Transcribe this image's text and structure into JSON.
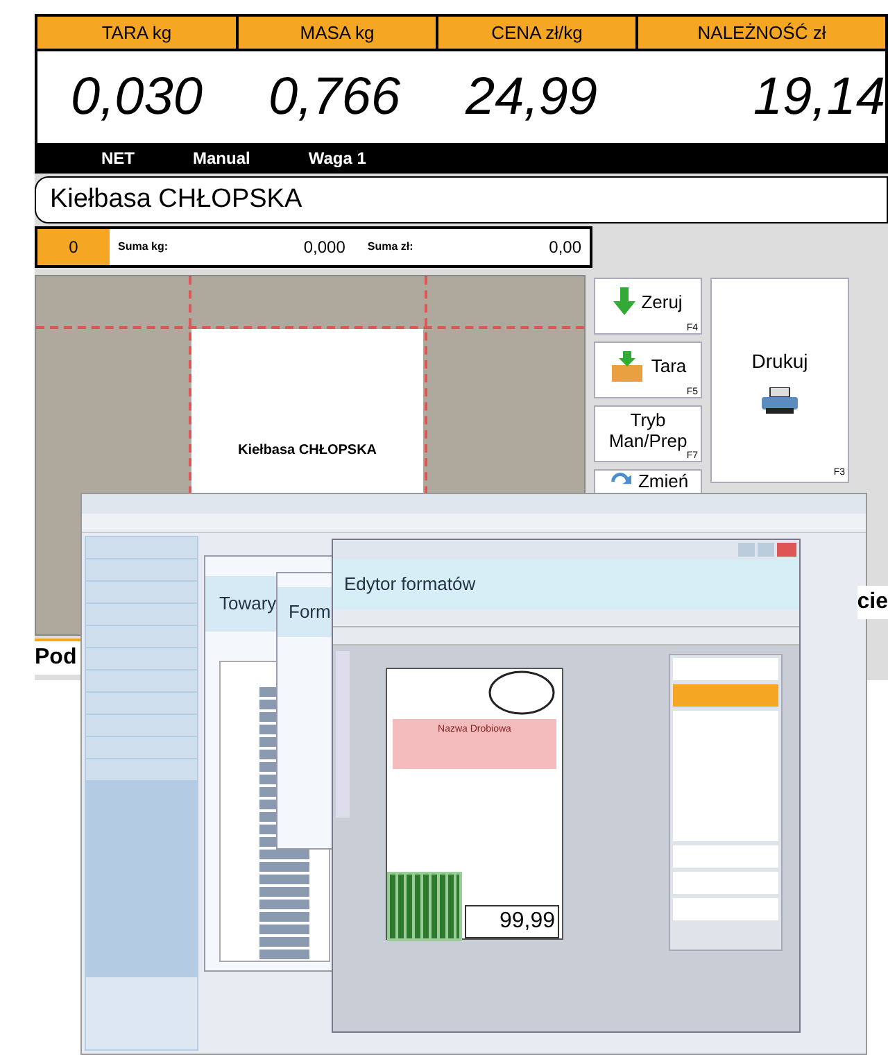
{
  "scale": {
    "columns": [
      {
        "label": "TARA kg",
        "value": "0,030"
      },
      {
        "label": "MASA kg",
        "value": "0,766"
      },
      {
        "label": "CENA zł/kg",
        "value": "24,99"
      },
      {
        "label": "NALEŻNOŚĆ zł",
        "value": "19,14"
      }
    ],
    "status": [
      "NET",
      "Manual",
      "Waga 1"
    ],
    "product": "Kiełbasa CHŁOPSKA",
    "counter": "0",
    "sums": [
      {
        "label": "Suma kg:",
        "value": "0,000"
      },
      {
        "label": "Suma zł:",
        "value": "0,00"
      }
    ],
    "label_preview": {
      "title": "Kiełbasa CHŁOPSKA"
    },
    "buttons": [
      {
        "label": "Zeruj",
        "key": "F4"
      },
      {
        "label": "Tara",
        "key": "F5"
      },
      {
        "label": "Tryb Man/Prep",
        "key": "F7"
      },
      {
        "label": "Zmień"
      }
    ],
    "print_button": {
      "label": "Drukuj",
      "key": "F3"
    },
    "bottom_text": "Pod",
    "right_text": "cie"
  },
  "app": {
    "windows": [
      {
        "title": "Towary"
      },
      {
        "title": "Form"
      }
    ],
    "editor": {
      "title": "Edytor formatów",
      "label_title": "Nazwa Drobiowa",
      "price": "99,99"
    }
  }
}
